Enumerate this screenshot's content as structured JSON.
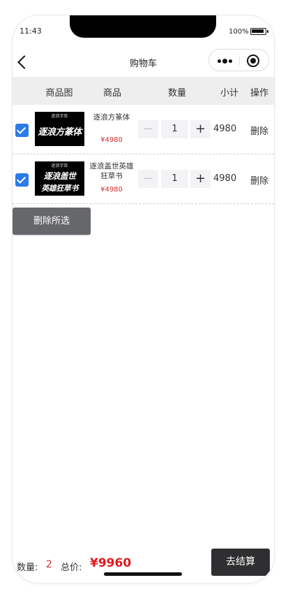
{
  "status_bar": {
    "time": "11:43",
    "battery": "100%"
  },
  "nav": {
    "title": "购物车"
  },
  "table": {
    "headers": [
      "商品图",
      "商品",
      "数量",
      "小计",
      "操作"
    ]
  },
  "items": [
    {
      "checked": true,
      "thumb_small": "逐浪字库",
      "thumb_text": "逐浪方篆体",
      "name": "逐浪方篆体",
      "price": "¥4980",
      "quantity": "1",
      "subtotal": "4980",
      "delete_label": "删除"
    },
    {
      "checked": true,
      "thumb_small": "逐浪字库",
      "thumb_text_line1": "逐浪盖世",
      "thumb_text_line2": "英雄狂草书",
      "name": "逐浪盖世英雄狂草书",
      "price": "¥4980",
      "quantity": "1",
      "subtotal": "4980",
      "delete_label": "删除"
    }
  ],
  "delete_selected_label": "删除所选",
  "footer": {
    "count_label": "数量:",
    "count_value": "2",
    "total_label": "总价:",
    "total_value": "¥9960",
    "checkout_label": "去结算"
  },
  "colors": {
    "accent_red": "#e0191e",
    "checkbox_blue": "#2b7be8",
    "dark_button": "#2f2f31",
    "gray_button": "#66676b"
  },
  "icons": [
    "back-icon",
    "more-icon",
    "target-icon",
    "check-icon",
    "minus-icon",
    "plus-icon"
  ]
}
